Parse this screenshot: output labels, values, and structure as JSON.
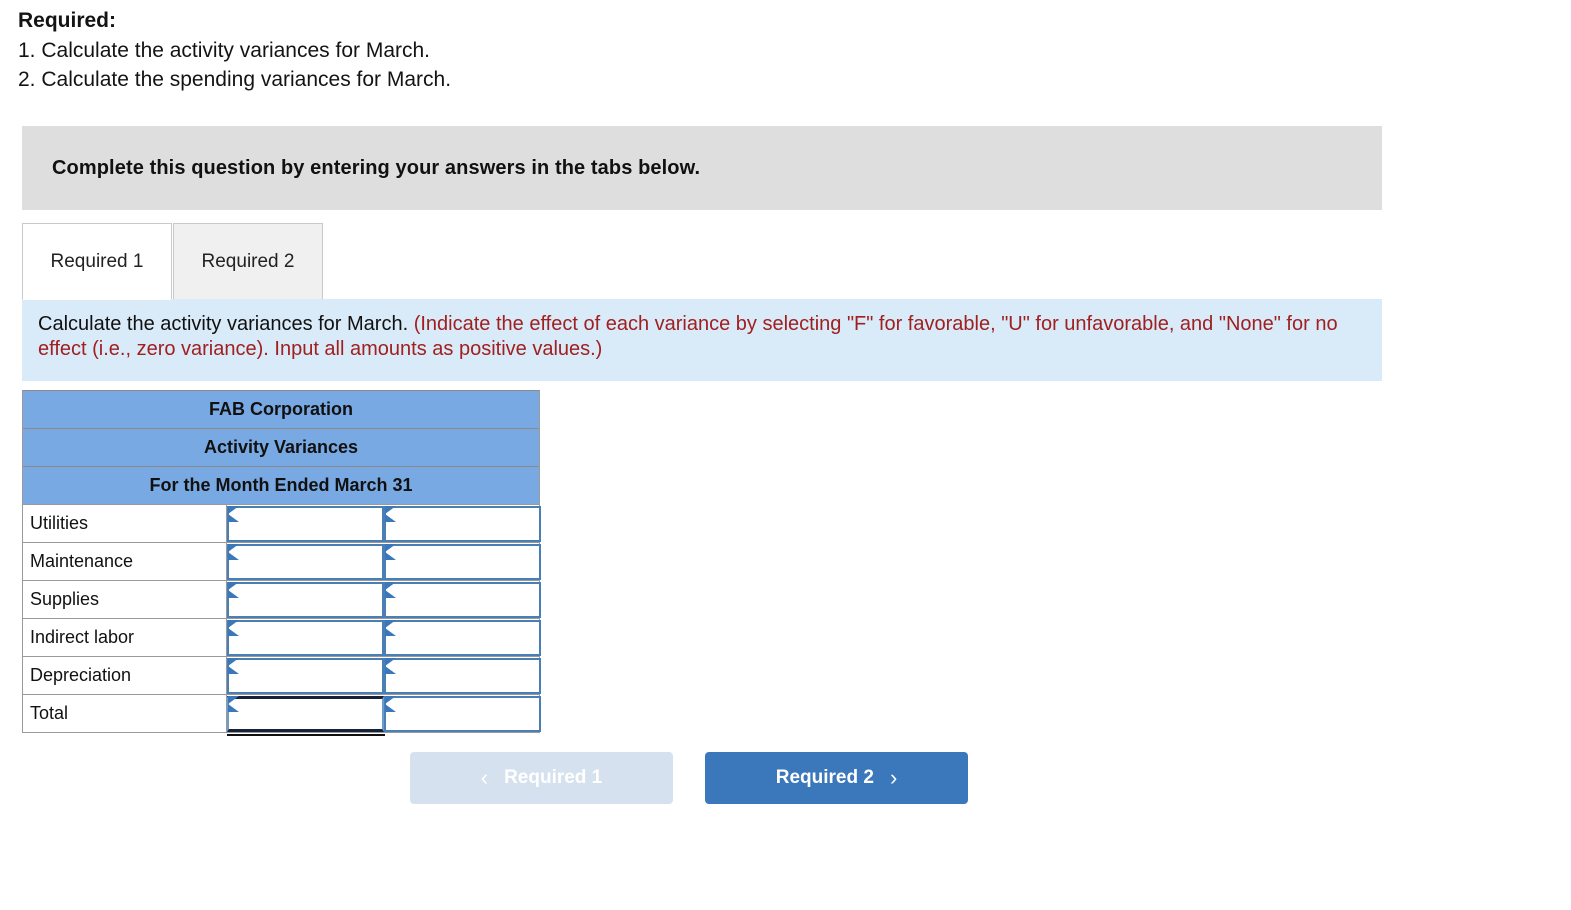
{
  "required_block": {
    "title": "Required:",
    "items": [
      "1. Calculate the activity variances for March.",
      "2. Calculate the spending variances for March."
    ]
  },
  "banner": {
    "text": "Complete this question by entering your answers in the tabs below."
  },
  "tabs": [
    {
      "label": "Required 1",
      "active": true
    },
    {
      "label": "Required 2",
      "active": false
    }
  ],
  "instruction": {
    "main": "Calculate the activity variances for March.",
    "hint": "(Indicate the effect of each variance by selecting \"F\" for favorable, \"U\" for unfavorable, and \"None\" for no effect (i.e., zero variance). Input all amounts as positive values.)",
    "hint_color": "#a02020",
    "background_color": "#d9eaf8"
  },
  "table": {
    "header_color": "#79a9e3",
    "titles": [
      "FAB Corporation",
      "Activity Variances",
      "For the Month Ended March 31"
    ],
    "rows": [
      {
        "label": "Utilities",
        "amount": "",
        "effect": "",
        "focused": false
      },
      {
        "label": "Maintenance",
        "amount": "",
        "effect": "",
        "focused": false
      },
      {
        "label": "Supplies",
        "amount": "",
        "effect": "",
        "focused": false
      },
      {
        "label": "Indirect labor",
        "amount": "",
        "effect": "",
        "focused": false
      },
      {
        "label": "Depreciation",
        "amount": "",
        "effect": "",
        "focused": false
      },
      {
        "label": "Total",
        "amount": "",
        "effect": "",
        "focused": true
      }
    ]
  },
  "nav": {
    "prev": {
      "label": "Required 1",
      "icon": "chevron-left",
      "glyph": "‹",
      "disabled": true,
      "color": "#d6e1ef"
    },
    "next": {
      "label": "Required 2",
      "icon": "chevron-right",
      "glyph": "›",
      "disabled": false,
      "color": "#3a77bb"
    }
  }
}
